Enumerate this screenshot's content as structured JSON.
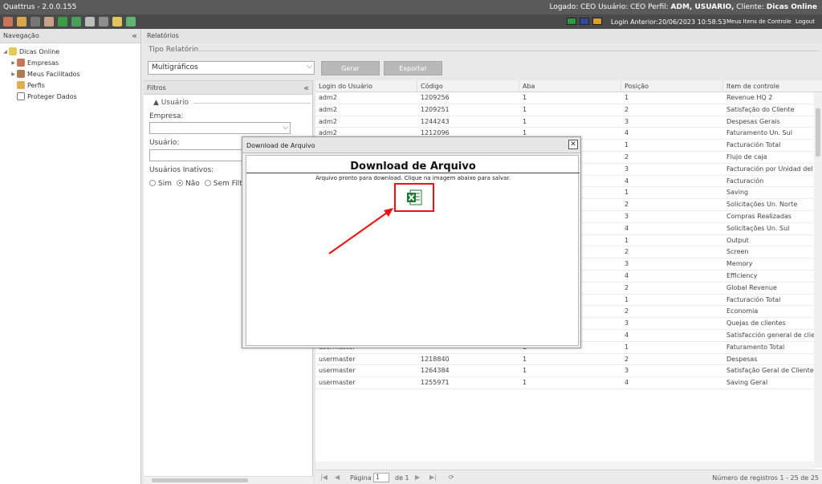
{
  "titlebar": {
    "app_title": "Quattrus - 2.0.0.155",
    "session_prefix": "Logado: CEO   Usuário: CEO   Perfil:",
    "profile": "ADM, USUARIO,",
    "client_prefix": "Cliente:",
    "client": "Dicas Online"
  },
  "toolbar": {
    "last_login": "Login Anterior:20/06/2023 10:58:53",
    "my_controls": "Meus Itens de Controle",
    "logout": "Logout"
  },
  "nav": {
    "title": "Navegação",
    "items": [
      {
        "label": "Dicas Online"
      },
      {
        "label": "Empresas"
      },
      {
        "label": "Meus Facilitados"
      },
      {
        "label": "Perfis"
      },
      {
        "label": "Proteger Dados"
      }
    ]
  },
  "main": {
    "title": "Relatórios",
    "report_type_legend": "Tipo Relatório",
    "report_type_value": "Multigráficos",
    "generate_label": "Gerar",
    "export_label": "Exportar"
  },
  "filters": {
    "title": "Filtros",
    "user_legend": "Usuário",
    "company_label": "Empresa:",
    "user_label": "Usuário:",
    "inactive_label": "Usuários Inativos:",
    "options": [
      "Sim",
      "Não",
      "Sem Filtro"
    ]
  },
  "grid": {
    "columns": [
      "Login do Usuário",
      "Código",
      "Aba",
      "Posição",
      "Item de controle"
    ],
    "rows": [
      [
        "adm2",
        "1209256",
        "1",
        "1",
        "Revenue HQ 2"
      ],
      [
        "adm2",
        "1209251",
        "1",
        "2",
        "Satisfação do Cliente"
      ],
      [
        "adm2",
        "1244243",
        "1",
        "3",
        "Despesas Gerais"
      ],
      [
        "adm2",
        "1212096",
        "1",
        "4",
        "Faturamento Un. Sul"
      ],
      [
        "",
        "",
        "",
        "1",
        "Facturación Total"
      ],
      [
        "",
        "",
        "",
        "2",
        "Flujo de caja"
      ],
      [
        "",
        "",
        "",
        "3",
        "Facturación por Unidad del Sur"
      ],
      [
        "",
        "",
        "",
        "4",
        "Facturación"
      ],
      [
        "",
        "",
        "",
        "1",
        "Saving"
      ],
      [
        "",
        "",
        "",
        "2",
        "Solicitações Un. Norte"
      ],
      [
        "",
        "",
        "",
        "3",
        "Compras Realizadas"
      ],
      [
        "",
        "",
        "",
        "4",
        "Solicitações Un. Sul"
      ],
      [
        "",
        "",
        "",
        "1",
        "Output"
      ],
      [
        "",
        "",
        "",
        "2",
        "Screen"
      ],
      [
        "",
        "",
        "",
        "3",
        "Memory"
      ],
      [
        "",
        "",
        "",
        "4",
        "Efficiency"
      ],
      [
        "",
        "",
        "",
        "2",
        "Global Revenue"
      ],
      [
        "",
        "",
        "",
        "1",
        "Facturación Total"
      ],
      [
        "",
        "",
        "",
        "2",
        "Economia"
      ],
      [
        "",
        "",
        "",
        "3",
        "Quejas de clientes"
      ],
      [
        "",
        "",
        "",
        "4",
        "Satisfacción general de clientes"
      ],
      [
        "usermaster",
        "",
        "1",
        "1",
        "Faturamento Total"
      ],
      [
        "usermaster",
        "1218840",
        "1",
        "2",
        "Despesas"
      ],
      [
        "usermaster",
        "1264384",
        "1",
        "3",
        "Satisfação Geral de Clientes"
      ],
      [
        "usermaster",
        "1255971",
        "1",
        "4",
        "Saving Geral"
      ]
    ],
    "pager": {
      "page_label": "Página",
      "page_value": "1",
      "of_label": "de 1",
      "count_label": "Número de registros 1 - 25 de 25"
    }
  },
  "modal": {
    "title": "Download de Arquivo",
    "heading": "Download de Arquivo",
    "message": "Arquivo pronto para download. Clique na imagem abaixo para salvar.",
    "close_label": "✕"
  },
  "colors": {
    "titlebar": "#5a5a5a",
    "toolbar": "#4a4a4a",
    "highlight": "#e11111",
    "excel_green": "#1e7b34"
  }
}
